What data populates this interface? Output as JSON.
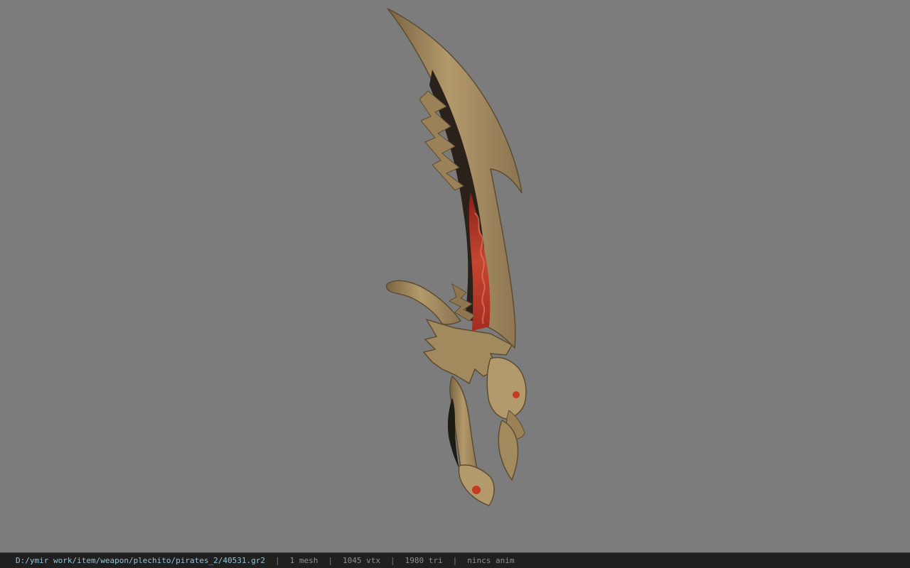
{
  "viewer": {
    "background_color": "#7c7c7c",
    "model": {
      "icon": "scimitar-weapon-model",
      "colors": {
        "bone": "#a88e63",
        "bone_dark": "#6e5a3a",
        "bone_light": "#c9b083",
        "inner_dark": "#2a211a",
        "lava": "#b8392a",
        "eye": "#c43a22"
      }
    }
  },
  "status_bar": {
    "file_path": "D:/ymir work/item/weapon/plechito/pirates_2/40531.gr2",
    "separator": "|",
    "mesh_count": "1 mesh",
    "vertex_count": "1045 vtx",
    "triangle_count": "1980 tri",
    "animation": "nincs anim"
  }
}
